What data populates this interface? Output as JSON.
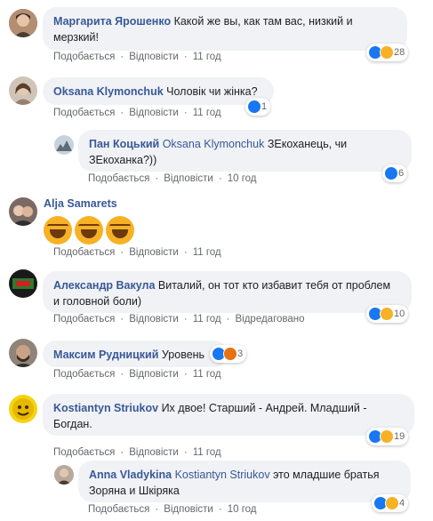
{
  "actions": {
    "like": "Подобається",
    "reply": "Відповісти",
    "edited": "Відредаговано"
  },
  "comments": [
    {
      "author": "Маргарита Ярошенко",
      "text_line1": "Какой же вы, как там вас, низкий и",
      "text_line2": "мерзкий!",
      "reactions": [
        "like-icon",
        "haha-icon"
      ],
      "count": "28",
      "time": "11 год"
    },
    {
      "author": "Oksana Klymonchuk",
      "text": "Чоловік чи жінка?",
      "reactions": [
        "like-icon"
      ],
      "count": "1",
      "time": "11 год"
    },
    {
      "author": "Пан Коцький",
      "mention": "Oksana Klymonchuk",
      "text_line1": "ЗЕкоханець, чи",
      "text_line2": "ЗЕкоханка?))",
      "reactions": [
        "like-icon"
      ],
      "count": "6",
      "time": "10 год"
    },
    {
      "author": "Alja Samarets",
      "emoji": [
        "haha-emoji",
        "haha-emoji",
        "haha-emoji"
      ],
      "time": "11 год"
    },
    {
      "author": "Александр Вакула",
      "text_line1": "Виталий, он тот кто избавит тебя от проблем",
      "text_line2": "и головной боли)",
      "reactions": [
        "like-icon",
        "haha-icon"
      ],
      "count": "10",
      "time": "11 год",
      "edited": true
    },
    {
      "author": "Максим Рудницкий",
      "text": "Уровень",
      "reactions": [
        "like-icon",
        "angry-icon"
      ],
      "count": "3",
      "time": "11 год"
    },
    {
      "author": "Kostiantyn Striukov",
      "text_line1": "Их двое! Старший - Андрей. Младший -",
      "text_line2": "Богдан.",
      "reactions": [
        "like-icon",
        "haha-icon"
      ],
      "count": "19",
      "time": "11 год"
    },
    {
      "author": "Anna Vladykina",
      "mention": "Kostiantyn Striukov",
      "text_line1": "это младшие братья",
      "text_line2": "Зоряна и Шкіряка",
      "reactions": [
        "like-icon",
        "haha-icon"
      ],
      "count": "4",
      "time": "10 год"
    }
  ],
  "colors": {
    "bubble": "#f0f2f5",
    "author": "#385898",
    "like": "#1877f2",
    "haha": "#f7b125",
    "angry": "#e9710f",
    "meta": "#65676b"
  }
}
